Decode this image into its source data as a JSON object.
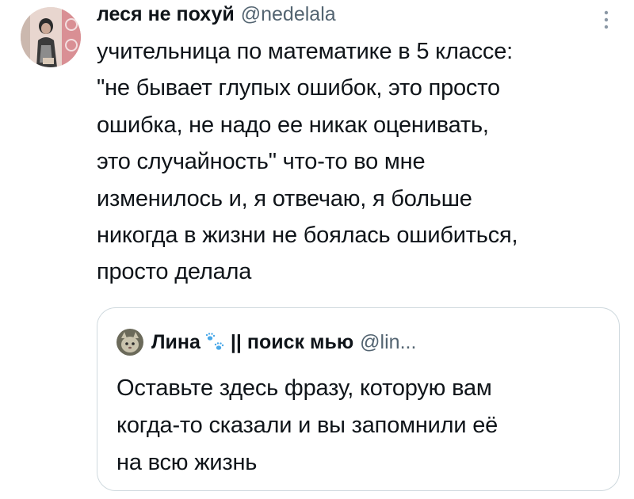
{
  "tweet": {
    "display_name": "леся не похуй",
    "handle": "@nedelala",
    "avatar_icon": "profile-photo",
    "more_icon": "more-vertical-icon",
    "text": "учительница по математике в 5 классе:\n\"не бывает глупых ошибок, это просто\nошибка, не надо ее никак оценивать,\nэто случайность\" что-то во мне\nизменилось и, я отвечаю, я больше\nникогда в жизни не боялась ошибиться,\nпросто делала"
  },
  "quote": {
    "display_name": "Лина",
    "name_suffix": "|| поиск мью",
    "handle": "@lin...",
    "avatar_icon": "profile-photo",
    "badge_icon": "paw-prints-icon",
    "text": "Оставьте здесь фразу, которую вам\nкогда-то сказали и вы запомнили её\nна всю жизнь"
  },
  "colors": {
    "text": "#0f1419",
    "secondary": "#536471",
    "border": "#cfd9de",
    "paw": "#4aa8e8"
  }
}
